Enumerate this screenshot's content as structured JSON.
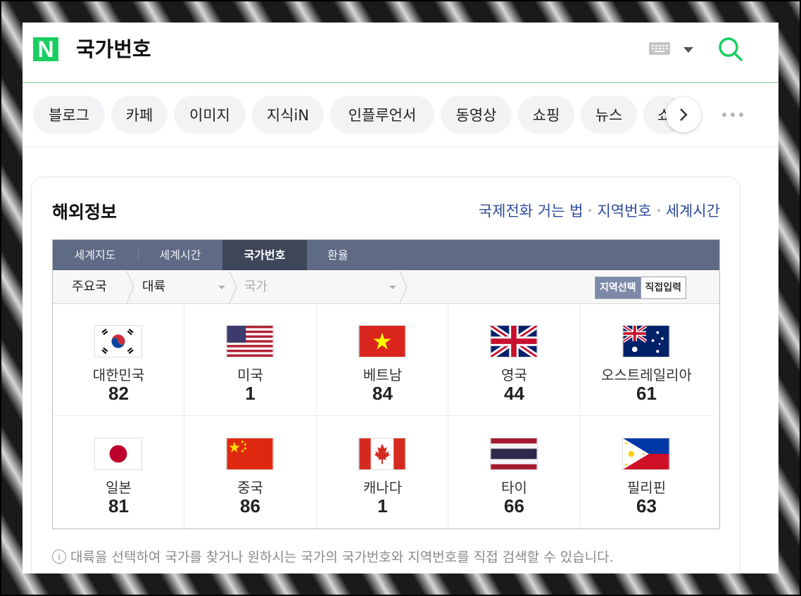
{
  "header": {
    "logo": "N",
    "query": "국가번호"
  },
  "tabs": [
    "블로그",
    "카페",
    "이미지",
    "지식iN",
    "인플루언서",
    "동영상",
    "쇼핑",
    "뉴스",
    "쇼"
  ],
  "card": {
    "title": "해외정보",
    "links": [
      "국제전화 거는 법",
      "지역번호",
      "세계시간"
    ]
  },
  "widget": {
    "tabs": [
      "세계지도",
      "세계시간",
      "국가번호",
      "환율"
    ],
    "active_tab": "국가번호",
    "selector": {
      "major": "주요국",
      "continent": "대륙",
      "country_placeholder": "국가"
    },
    "modes": [
      "지역선택",
      "직접입력"
    ],
    "active_mode": "지역선택",
    "countries": [
      {
        "name": "대한민국",
        "code": "82",
        "flag": "flag-south-korea-icon"
      },
      {
        "name": "미국",
        "code": "1",
        "flag": "flag-usa-icon"
      },
      {
        "name": "베트남",
        "code": "84",
        "flag": "flag-vietnam-icon"
      },
      {
        "name": "영국",
        "code": "44",
        "flag": "flag-uk-icon"
      },
      {
        "name": "오스트레일리아",
        "code": "61",
        "flag": "flag-australia-icon"
      },
      {
        "name": "일본",
        "code": "81",
        "flag": "flag-japan-icon"
      },
      {
        "name": "중국",
        "code": "86",
        "flag": "flag-china-icon"
      },
      {
        "name": "캐나다",
        "code": "1",
        "flag": "flag-canada-icon"
      },
      {
        "name": "타이",
        "code": "66",
        "flag": "flag-thailand-icon"
      },
      {
        "name": "필리핀",
        "code": "63",
        "flag": "flag-philippines-icon"
      }
    ]
  },
  "note": "대륙을 선택하여 국가를 찾거나 원하시는 국가의 국가번호와 지역번호를 직접 검색할 수 있습니다.",
  "colors": {
    "brand_green": "#19ce60",
    "link_blue": "#2d4b9a",
    "tab_bar": "#5f6a84"
  }
}
